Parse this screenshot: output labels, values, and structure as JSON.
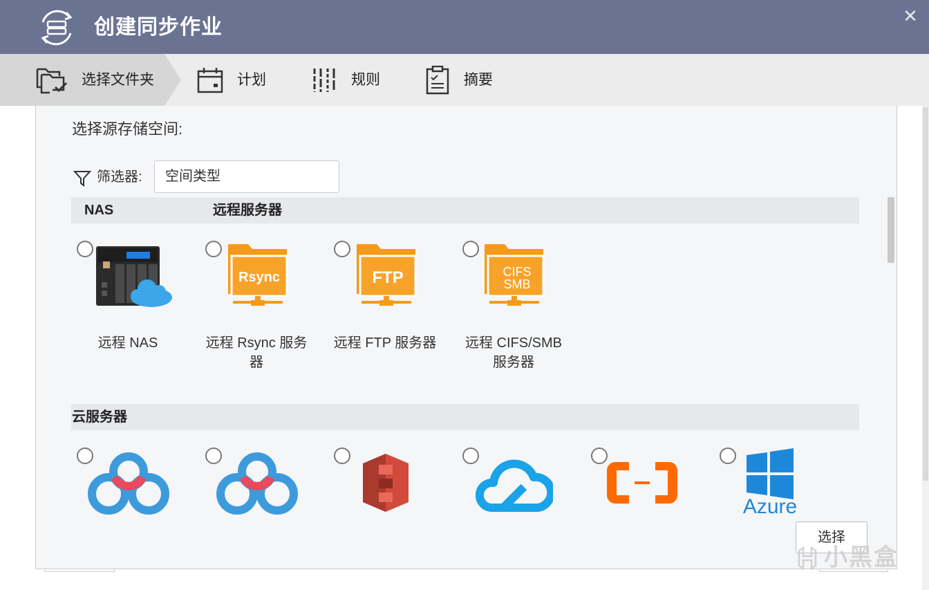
{
  "window": {
    "title": "创建同步作业",
    "close_glyph": "✕"
  },
  "steps": [
    {
      "label": "选择文件夹",
      "icon": "folder-check-icon",
      "active": true
    },
    {
      "label": "计划",
      "icon": "calendar-icon",
      "active": false
    },
    {
      "label": "规则",
      "icon": "sliders-icon",
      "active": false
    },
    {
      "label": "摘要",
      "icon": "clipboard-icon",
      "active": false
    }
  ],
  "main": {
    "source_label": "选择源存储空间:",
    "filter_label": "筛选器:",
    "filter_value": "空间类型"
  },
  "sections": {
    "nas": "NAS",
    "remote": "远程服务器",
    "cloud": "云服务器"
  },
  "remote_items": [
    {
      "label_line1": "远程 NAS",
      "label_line2": "",
      "icon": "remote-nas-icon"
    },
    {
      "label_line1": "远程 Rsync 服务",
      "label_line2": "器",
      "icon_text": "Rsync",
      "icon": "rsync-folder-icon"
    },
    {
      "label_line1": "远程 FTP 服务器",
      "label_line2": "",
      "icon_text": "FTP",
      "icon": "ftp-folder-icon"
    },
    {
      "label_line1": "远程 CIFS/SMB",
      "label_line2": "服务器",
      "icon_text_1": "CIFS",
      "icon_text_2": "SMB",
      "icon": "cifs-smb-folder-icon"
    }
  ],
  "cloud_items": [
    {
      "icon": "baidu-cloud-icon"
    },
    {
      "icon": "baidu-cloud-icon"
    },
    {
      "icon": "amazon-s3-icon"
    },
    {
      "icon": "tencent-cloud-icon"
    },
    {
      "icon": "alibaba-cloud-icon"
    },
    {
      "icon": "azure-icon",
      "icon_text": "Azure"
    }
  ],
  "footer": {
    "select_button": "选择"
  },
  "watermark": {
    "text": "小黑盒"
  },
  "colors": {
    "titlebar": "#6a7392",
    "folder_orange": "#f59a1a",
    "baidu_blue": "#3d9bdb",
    "baidu_red": "#e94a5d",
    "s3_red": "#d24a3b",
    "tencent_blue": "#1aa3e8",
    "alibaba_orange": "#ff6a00",
    "azure_blue": "#1e88d8"
  }
}
